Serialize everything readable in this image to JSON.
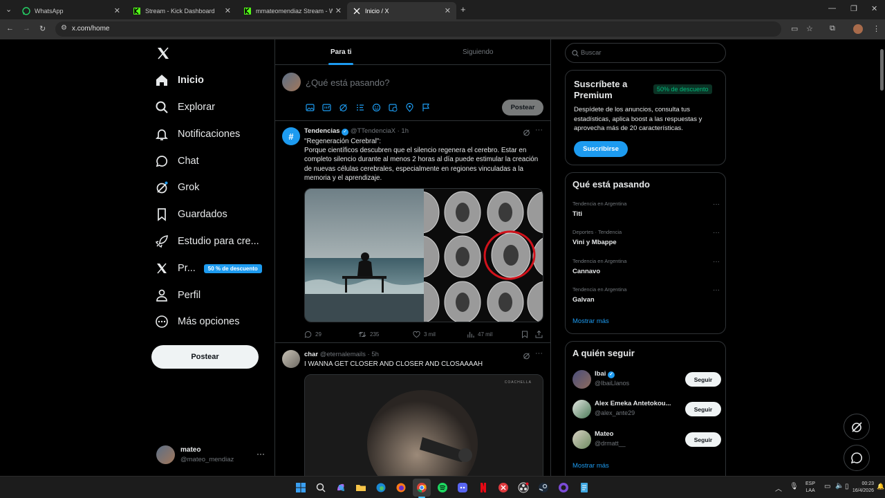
{
  "browser": {
    "tabs": [
      {
        "label": "WhatsApp",
        "icon": "whatsapp-icon",
        "active": false
      },
      {
        "label": "Stream - Kick Dashboard",
        "icon": "kick-icon",
        "active": false
      },
      {
        "label": "mmateomendiaz Stream - Watch",
        "icon": "kick-icon",
        "active": false
      },
      {
        "label": "Inicio / X",
        "icon": "x-icon",
        "active": true
      }
    ],
    "new_tab": "+",
    "url": "x.com/home"
  },
  "nav": {
    "items": [
      {
        "label": "Inicio",
        "icon": "home-icon"
      },
      {
        "label": "Explorar",
        "icon": "search-icon"
      },
      {
        "label": "Notificaciones",
        "icon": "bell-icon"
      },
      {
        "label": "Chat",
        "icon": "chat-icon"
      },
      {
        "label": "Grok",
        "icon": "grok-icon"
      },
      {
        "label": "Guardados",
        "icon": "bookmark-icon"
      },
      {
        "label": "Estudio para cre...",
        "icon": "rocket-icon"
      },
      {
        "label": "Pr...",
        "icon": "x-icon"
      },
      {
        "label": "Perfil",
        "icon": "user-icon"
      },
      {
        "label": "Más opciones",
        "icon": "more-icon"
      }
    ],
    "premium_badge": "50 % de descuento",
    "post_button": "Postear",
    "account": {
      "name": "mateo",
      "handle": "@mateo_mendiaz",
      "more": "···"
    }
  },
  "feed": {
    "tabs": [
      "Para ti",
      "Siguiendo"
    ],
    "composer": {
      "placeholder": "¿Qué está pasando?",
      "post_button": "Postear"
    },
    "posts": [
      {
        "author": "Tendencias",
        "handle": "@TTendenciaX",
        "time": "· 1h",
        "text_title": "\"Regeneración Cerebral\":",
        "text_body": "Porque científicos descubren que el silencio regenera el cerebro. Estar en completo silencio durante al menos 2 horas al día puede estimular la creación de nuevas células cerebrales, especialmente en regiones vinculadas a la memoria y el aprendizaje.",
        "replies": "29",
        "reposts": "235",
        "likes": "3 mil",
        "views": "47 mil"
      },
      {
        "author": "char",
        "handle": "@eternalemails",
        "time": "· 5h",
        "text": "I WANNA GET CLOSER AND CLOSER AND CLOSAAAAH",
        "video_watermark": "COACHELLA"
      }
    ]
  },
  "sidebar": {
    "search_placeholder": "Buscar",
    "premium": {
      "title": "Suscríbete a Premium",
      "badge": "50% de descuento",
      "text": "Despídete de los anuncios, consulta tus estadísticas, aplica boost a las respuestas y aprovecha más de 20 características.",
      "button": "Suscribirse"
    },
    "trends": {
      "title": "Qué está pasando",
      "items": [
        {
          "meta": "Tendencia en Argentina",
          "name": "Titi"
        },
        {
          "meta": "Deportes · Tendencia",
          "name": "Vini y Mbappe"
        },
        {
          "meta": "Tendencia en Argentina",
          "name": "Cannavo"
        },
        {
          "meta": "Tendencia en Argentina",
          "name": "Galvan"
        }
      ],
      "more": "Mostrar más"
    },
    "who_to_follow": {
      "title": "A quién seguir",
      "items": [
        {
          "name": "Ibai",
          "handle": "@IbaiLlanos",
          "button": "Seguir"
        },
        {
          "name": "Alex Emeka Antetokou...",
          "handle": "@alex_ante29",
          "button": "Seguir"
        },
        {
          "name": "Mateo",
          "handle": "@drmatt__",
          "button": "Seguir"
        }
      ],
      "more": "Mostrar más"
    }
  },
  "taskbar": {
    "lang": "ESP",
    "lang2": "LAA",
    "time": "00:23",
    "date": "16/4/2026"
  },
  "colors": {
    "accent": "#1d9bf0",
    "bg": "#000000",
    "border": "#2f3336",
    "muted": "#71767b",
    "green_badge": "#00ba7c"
  }
}
